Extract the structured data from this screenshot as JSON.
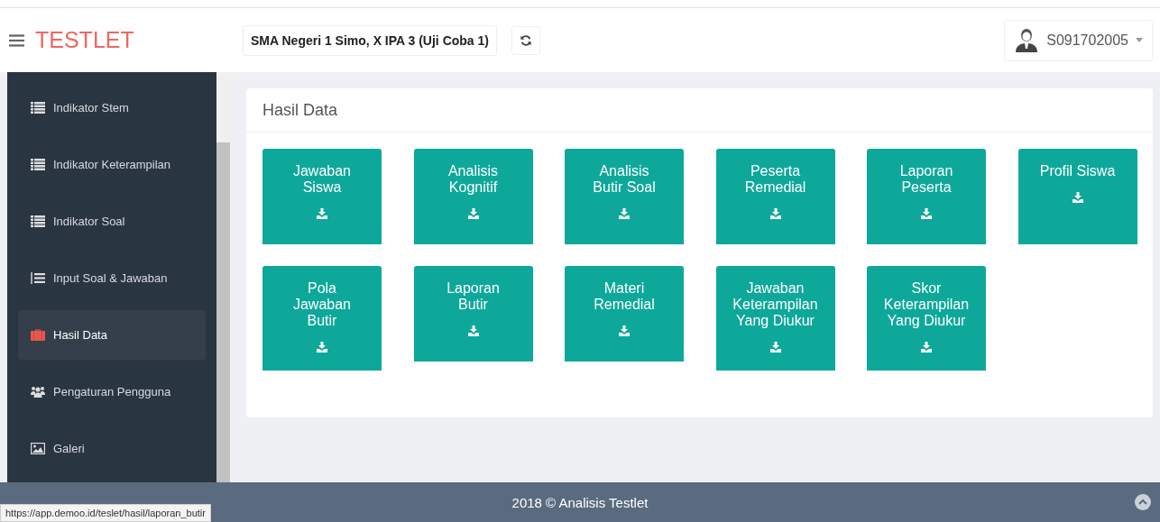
{
  "header": {
    "brand": "TESTLET",
    "class_selector": "SMA Negeri 1 Simo, X IPA 3 (Uji Coba 1)",
    "user": "S091702005"
  },
  "sidebar": {
    "items": [
      {
        "label": "Indikator Stem",
        "kind": "list",
        "selected": false
      },
      {
        "label": "Indikator Keterampilan",
        "kind": "list",
        "selected": false
      },
      {
        "label": "Indikator Soal",
        "kind": "list",
        "selected": false
      },
      {
        "label": "Input Soal & Jawaban",
        "kind": "numbered",
        "selected": false
      },
      {
        "label": "Hasil Data",
        "kind": "briefcase",
        "selected": true
      },
      {
        "label": "Pengaturan Pengguna",
        "kind": "users",
        "selected": false
      },
      {
        "label": "Galeri",
        "kind": "image",
        "selected": false
      }
    ]
  },
  "panel": {
    "title": "Hasil Data",
    "tiles": [
      [
        "Jawaban",
        "Siswa"
      ],
      [
        "Analisis",
        "Kognitif"
      ],
      [
        "Analisis",
        "Butir Soal"
      ],
      [
        "Peserta",
        "Remedial"
      ],
      [
        "Laporan",
        "Peserta"
      ],
      [
        "Profil Siswa"
      ],
      [
        "Pola",
        "Jawaban",
        "Butir"
      ],
      [
        "Laporan",
        "Butir"
      ],
      [
        "Materi",
        "Remedial"
      ],
      [
        "Jawaban",
        "Keterampilan",
        "Yang Diukur"
      ],
      [
        "Skor",
        "Keterampilan",
        "Yang Diukur"
      ]
    ]
  },
  "footer": {
    "text": "2018 © Analisis Testlet"
  },
  "status_url": "https://app.demoo.id/teslet/hasil/laporan_butir"
}
